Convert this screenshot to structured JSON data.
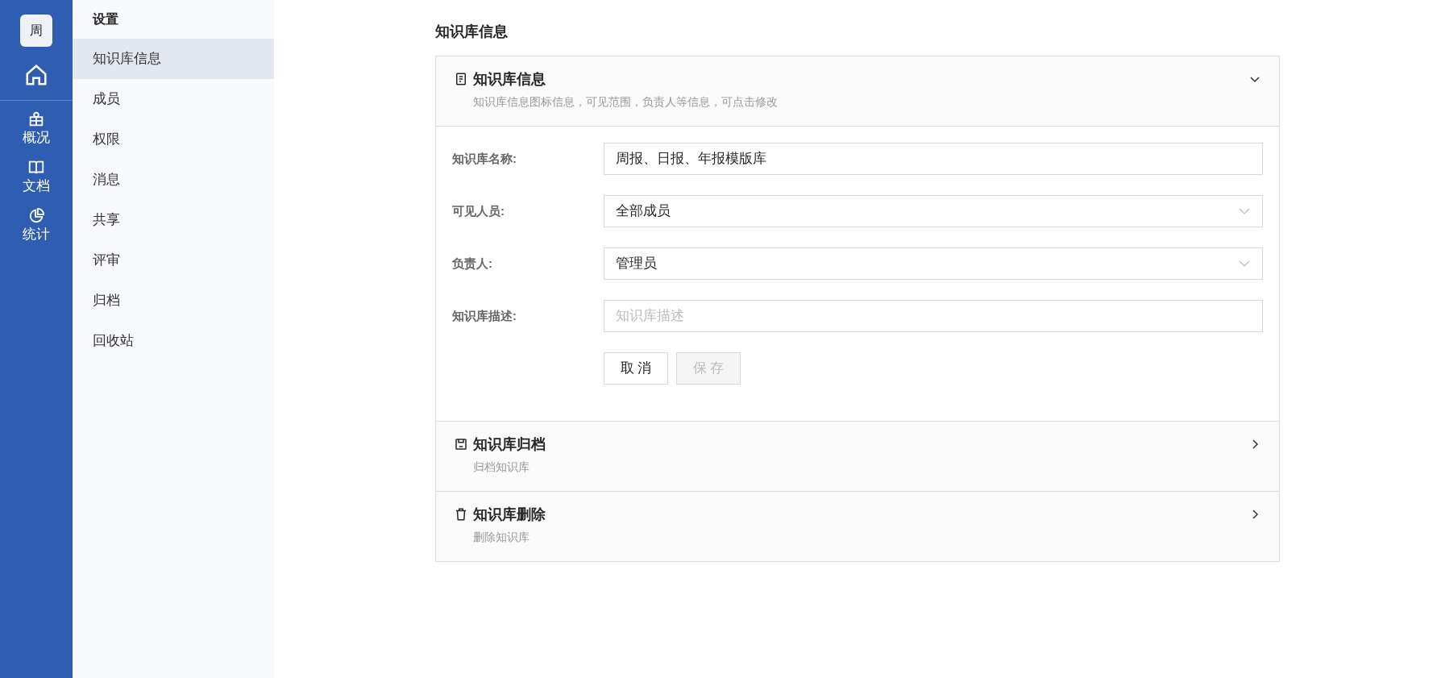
{
  "rail": {
    "avatar": "周",
    "items": [
      {
        "kind": "overview",
        "label": "概况"
      },
      {
        "kind": "docs",
        "label": "文档"
      },
      {
        "kind": "stats",
        "label": "统计"
      }
    ]
  },
  "sidebar": {
    "title": "设置",
    "items": [
      {
        "label": "知识库信息",
        "selected": true
      },
      {
        "label": "成员",
        "selected": false
      },
      {
        "label": "权限",
        "selected": false
      },
      {
        "label": "消息",
        "selected": false
      },
      {
        "label": "共享",
        "selected": false
      },
      {
        "label": "评审",
        "selected": false
      },
      {
        "label": "归档",
        "selected": false
      },
      {
        "label": "回收站",
        "selected": false
      }
    ]
  },
  "page_title": "知识库信息",
  "sections": [
    {
      "kind": "info",
      "title": "知识库信息",
      "subtitle": "知识库信息图标信息，可见范围，负责人等信息，可点击修改",
      "expanded": true,
      "fields": [
        {
          "kind": "text",
          "label": "知识库名称:",
          "value": "周报、日报、年报模版库"
        },
        {
          "kind": "select",
          "label": "可见人员:",
          "value": "全部成员"
        },
        {
          "kind": "select",
          "label": "负责人:",
          "value": "管理员"
        },
        {
          "kind": "text",
          "label": "知识库描述:",
          "placeholder": "知识库描述"
        }
      ],
      "buttons": [
        {
          "label": "取 消",
          "disabled": false
        },
        {
          "label": "保 存",
          "disabled": true
        }
      ]
    },
    {
      "kind": "archive",
      "title": "知识库归档",
      "subtitle": "归档知识库",
      "expanded": false
    },
    {
      "kind": "delete",
      "title": "知识库删除",
      "subtitle": "删除知识库",
      "expanded": false
    }
  ]
}
